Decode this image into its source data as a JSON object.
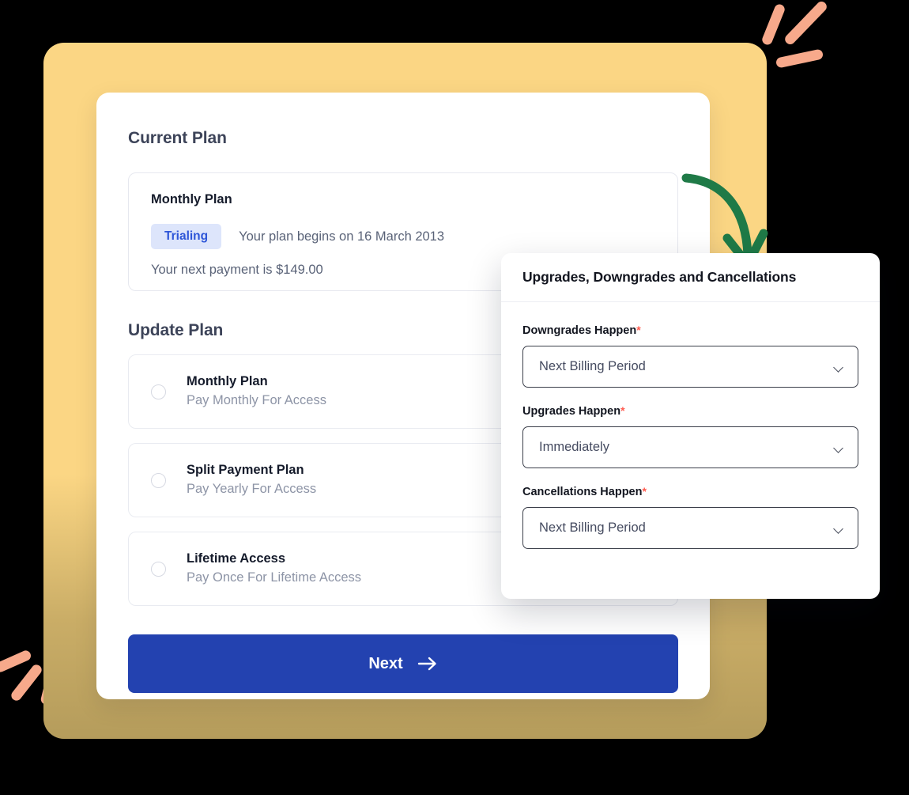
{
  "decor": {
    "yellow_card_color": "#fbd684",
    "coral_color": "#f7a98b",
    "green_arrow_color": "#1f7a47",
    "accent_blue": "#2342b0",
    "badge_bg": "#dde5fb",
    "badge_text_color": "#2e56d8",
    "required_star_color": "#ff5a4e",
    "green_arrow_name": "curved-down-arrow-icon"
  },
  "main": {
    "current_plan": {
      "section_title": "Current Plan",
      "plan_name": "Monthly Plan",
      "status_badge": "Trialing",
      "begins_text": "Your plan begins on 16 March 2013",
      "next_payment_text": "Your next payment is $149.00"
    },
    "update_plan": {
      "section_title": "Update Plan",
      "options": [
        {
          "label": "Monthly Plan",
          "sub": "Pay Monthly For Access",
          "selected": false
        },
        {
          "label": "Split Payment Plan",
          "sub": "Pay Yearly For Access",
          "selected": false
        },
        {
          "label": "Lifetime Access",
          "sub": "Pay Once For Lifetime Access",
          "selected": false
        }
      ]
    },
    "next_button": {
      "label": "Next",
      "arrow_glyph": "→"
    }
  },
  "panel": {
    "title": "Upgrades, Downgrades and Cancellations",
    "fields": [
      {
        "label": "Downgrades Happen",
        "required": "*",
        "value": "Next Billing Period"
      },
      {
        "label": "Upgrades Happen",
        "required": "*",
        "value": "Immediately"
      },
      {
        "label": "Cancellations Happen",
        "required": "*",
        "value": "Next Billing Period"
      }
    ]
  }
}
